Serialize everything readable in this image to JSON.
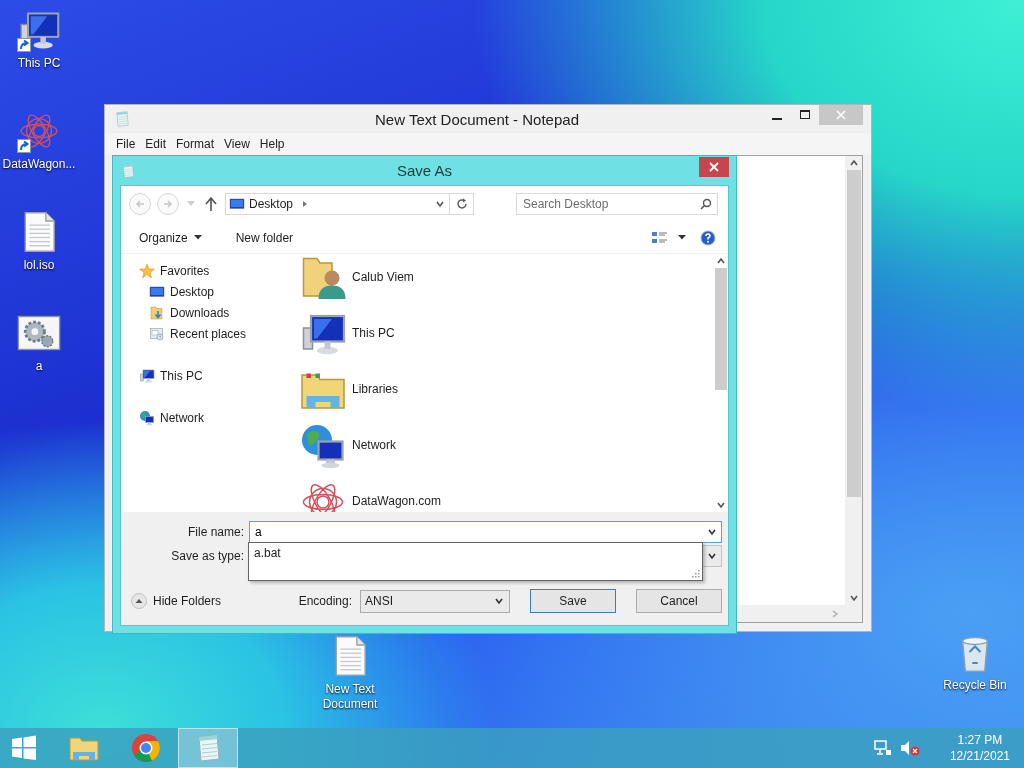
{
  "desktop": {
    "icons": [
      {
        "label": "This PC",
        "kind": "computer",
        "shortcut": true
      },
      {
        "label": "DataWagon...",
        "kind": "web-logo",
        "shortcut": true
      },
      {
        "label": "lol.iso",
        "kind": "document",
        "shortcut": false
      },
      {
        "label": "a",
        "kind": "gears",
        "shortcut": false
      }
    ],
    "free_icons": [
      {
        "label": "New Text Document",
        "kind": "document",
        "shortcut": false
      },
      {
        "label": "Recycle Bin",
        "kind": "recycle-bin",
        "shortcut": false
      }
    ]
  },
  "notepad": {
    "title": "New Text Document - Notepad",
    "menu": [
      "File",
      "Edit",
      "Format",
      "View",
      "Help"
    ]
  },
  "save_dialog": {
    "title": "Save As",
    "address": "Desktop",
    "search": {
      "placeholder": "Search Desktop"
    },
    "toolbar": [
      "Organize",
      "New folder"
    ],
    "nav_tree": [
      {
        "label": "Favorites",
        "kind": "star",
        "children": [
          {
            "label": "Desktop",
            "kind": "monitor"
          },
          {
            "label": "Downloads",
            "kind": "downloads"
          },
          {
            "label": "Recent places",
            "kind": "recent"
          }
        ]
      },
      {
        "label": "This PC",
        "kind": "computer"
      },
      {
        "label": "Network",
        "kind": "network"
      }
    ],
    "items": [
      {
        "name": "Calub Viem",
        "kind": "user-folder"
      },
      {
        "name": "This PC",
        "kind": "computer"
      },
      {
        "name": "Libraries",
        "kind": "libraries"
      },
      {
        "name": "Network",
        "kind": "network"
      },
      {
        "name": "DataWagon.com",
        "kind": "web-logo"
      }
    ],
    "file_name": {
      "label": "File name:",
      "value": "a"
    },
    "suggestions": [
      "a.bat"
    ],
    "save_as_type": {
      "label": "Save as type:"
    },
    "hide_folders": "Hide Folders",
    "encoding": {
      "label": "Encoding:",
      "value": "ANSI"
    },
    "buttons": [
      {
        "label": "Save",
        "default": true
      },
      {
        "label": "Cancel",
        "default": false
      }
    ]
  },
  "taskbar": {
    "apps": [
      {
        "kind": "explorer",
        "selected": false
      },
      {
        "kind": "chrome",
        "selected": false
      },
      {
        "kind": "notepad",
        "selected": true
      }
    ],
    "time": "1:27 PM",
    "date": "12/21/2021"
  }
}
